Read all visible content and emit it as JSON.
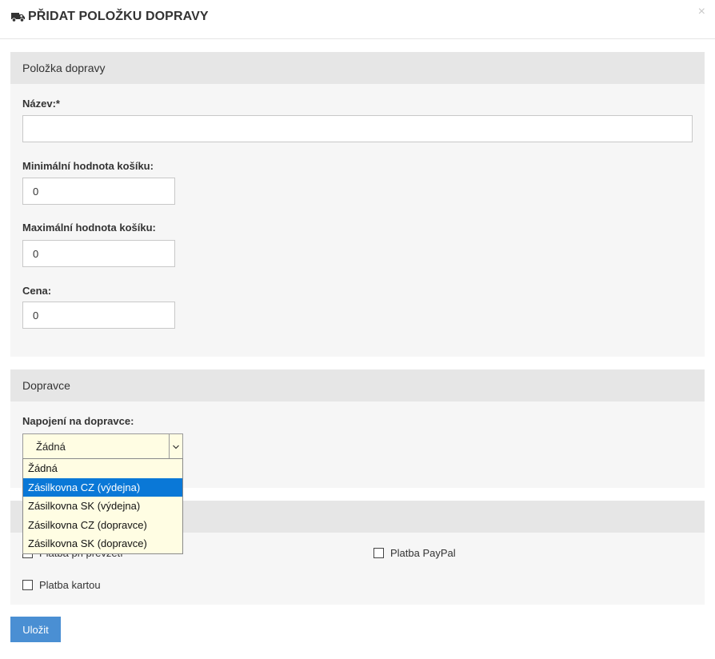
{
  "modal": {
    "title": "PŘIDAT POLOŽKU DOPRAVY",
    "title_icon": "truck-icon",
    "close_icon": "close-icon",
    "close_glyph": "×"
  },
  "section_item": {
    "heading": "Položka dopravy",
    "name": {
      "label": "Název:*",
      "value": ""
    },
    "min_cart": {
      "label": "Minimální hodnota košíku:",
      "value": "0"
    },
    "max_cart": {
      "label": "Maximální hodnota košíku:",
      "value": "0"
    },
    "price": {
      "label": "Cena:",
      "value": "0"
    }
  },
  "section_carrier": {
    "heading": "Dopravce",
    "connection": {
      "label": "Napojení na dopravce:",
      "selected": "Žádná",
      "options": [
        "Žádná",
        "Zásilkovna CZ (výdejna)",
        "Zásilkovna SK (výdejna)",
        "Zásilkovna CZ (dopravce)",
        "Zásilkovna SK (dopravce)"
      ],
      "highlighted_index": 1
    }
  },
  "section_payment": {
    "options": [
      {
        "label": "Platba při převzetí",
        "checked": false
      },
      {
        "label": "Platba PayPal",
        "checked": false
      },
      {
        "label": "Platba kartou",
        "checked": false
      }
    ]
  },
  "actions": {
    "save_label": "Uložit"
  },
  "colors": {
    "primary_button": "#4a8fd3",
    "dropdown_highlight": "#0a78d7",
    "select_background": "#fffde3",
    "section_header": "#e6e6e6",
    "section_body": "#f6f6f6"
  }
}
